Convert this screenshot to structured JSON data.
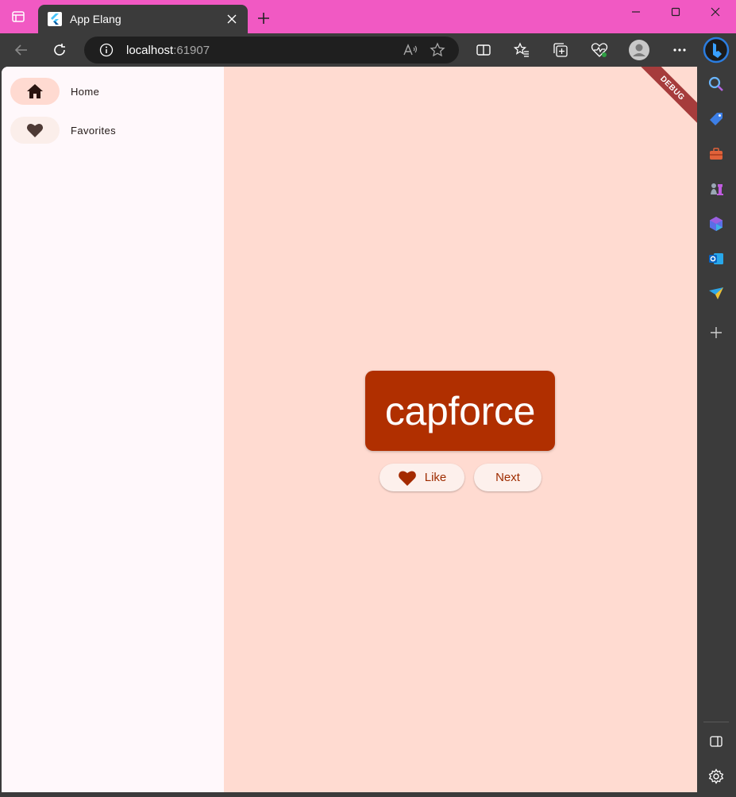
{
  "browser": {
    "tab_title": "App Elang",
    "url_host": "localhost",
    "url_port": ":61907"
  },
  "app": {
    "nav": [
      {
        "label": "Home",
        "icon": "home-icon",
        "selected": true
      },
      {
        "label": "Favorites",
        "icon": "heart-icon",
        "selected": false
      }
    ],
    "word": "capforce",
    "like_label": "Like",
    "next_label": "Next",
    "debug_banner": "DEBUG"
  },
  "colors": {
    "titlebar": "#f159c3",
    "chrome": "#3b3b3b",
    "card": "#b02f00",
    "main_bg": "#ffdbd1",
    "rail_bg": "#fff8fb",
    "accent_text": "#9e2c00"
  }
}
